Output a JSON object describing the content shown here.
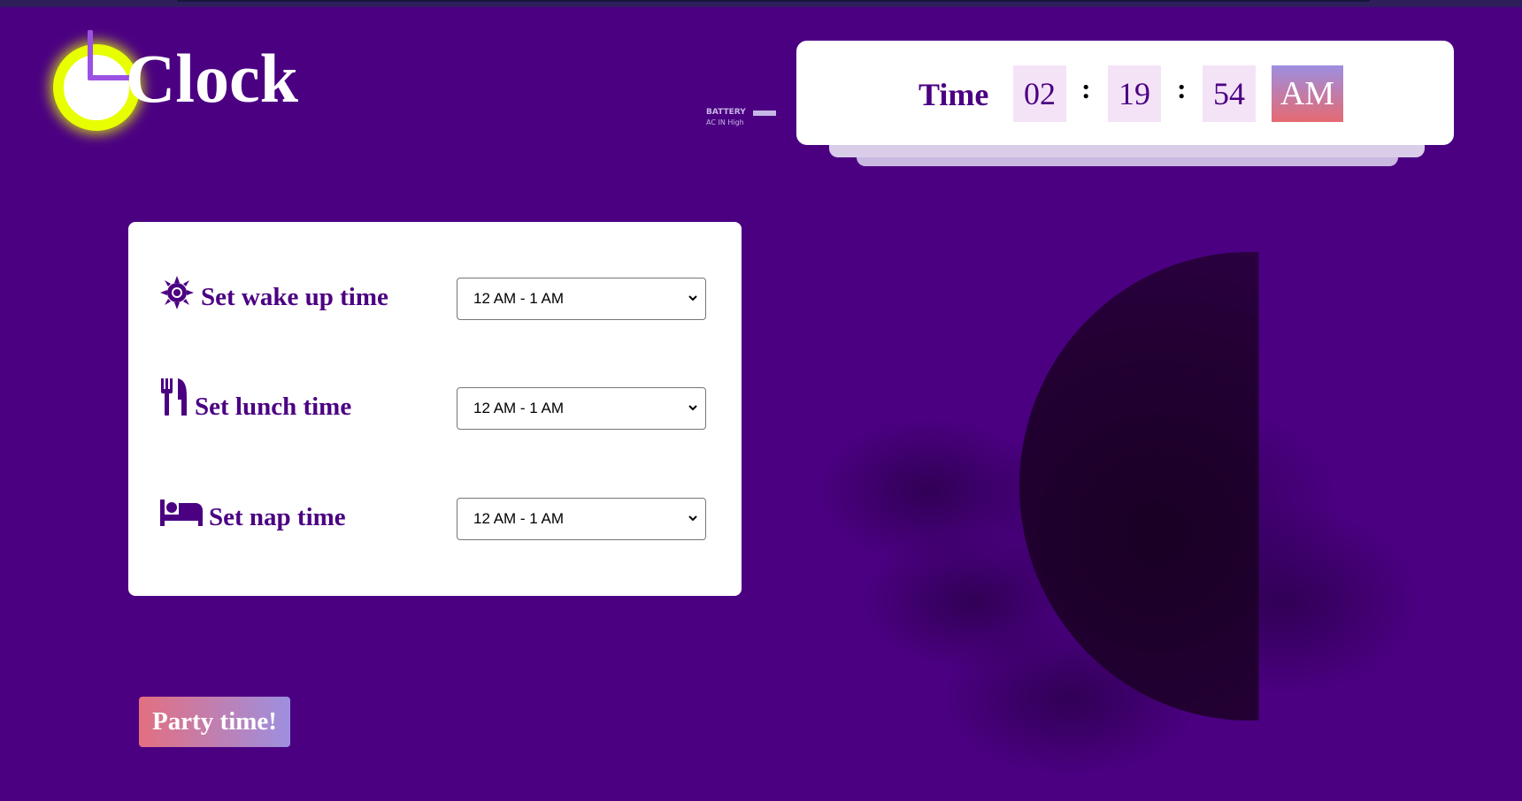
{
  "app": {
    "logo_text": "Clock"
  },
  "battery": {
    "label": "BATTERY",
    "sub": "AC IN   High"
  },
  "clock": {
    "label": "Time",
    "hours": "02",
    "minutes": "19",
    "seconds": "54",
    "separator": ":",
    "period": "AM"
  },
  "settings": {
    "wake": {
      "label": "Set wake up time",
      "selected": "12 AM - 1 AM",
      "icon": "sun-icon"
    },
    "lunch": {
      "label": "Set lunch time",
      "selected": "12 AM - 1 AM",
      "icon": "utensils-icon"
    },
    "nap": {
      "label": "Set nap time",
      "selected": "12 AM - 1 AM",
      "icon": "bed-icon"
    }
  },
  "party_button": {
    "label": "Party time!"
  },
  "colors": {
    "background": "#4b0082",
    "accent_yellow": "#e7ff00",
    "card": "#ffffff",
    "digit_box": "#f4e3f7",
    "gradient_pink": "#e36f80",
    "gradient_lavender": "#9d8fe0"
  }
}
